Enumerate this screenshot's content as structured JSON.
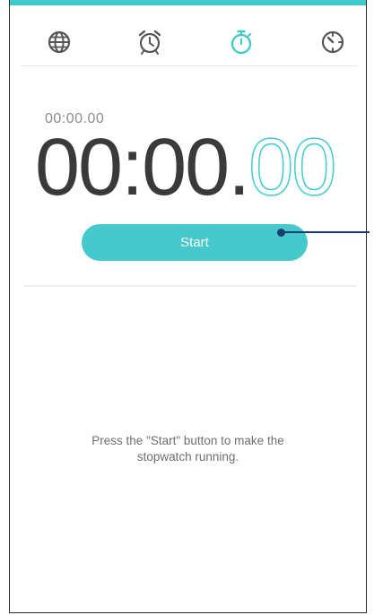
{
  "tabs": [
    {
      "name": "world-clock",
      "icon": "globe-icon",
      "active": false
    },
    {
      "name": "alarm",
      "icon": "alarm-clock-icon",
      "active": false
    },
    {
      "name": "stopwatch",
      "icon": "stopwatch-icon",
      "active": true
    },
    {
      "name": "timer",
      "icon": "timer-icon",
      "active": false
    }
  ],
  "stopwatch": {
    "lap_time": "00:00.00",
    "main_time": "00:00.",
    "centiseconds": "00"
  },
  "start_button": {
    "label": "Start"
  },
  "hint": {
    "line1": "Press the \"Start\" button to make the",
    "line2": "stopwatch running."
  },
  "colors": {
    "accent": "#46c9cc",
    "text_dark": "#3a3a3a",
    "text_muted": "#6e6e6e",
    "icon_inactive": "#555555",
    "callout": "#1a3d6e"
  }
}
